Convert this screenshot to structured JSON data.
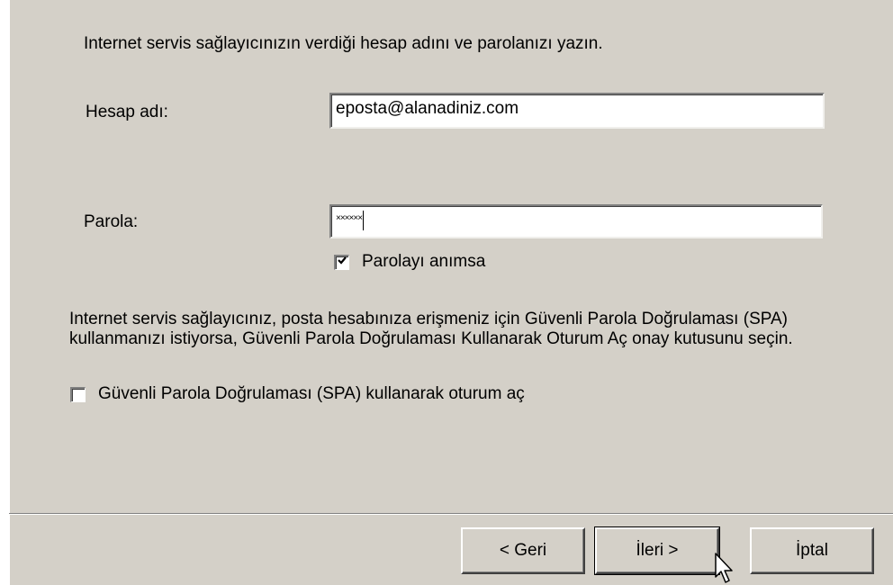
{
  "instruction": "Internet servis sağlayıcınızın verdiği hesap adını ve parolanızı yazın.",
  "account": {
    "label": "Hesap adı:",
    "value": "eposta@alanadiniz.com"
  },
  "password": {
    "label": "Parola:",
    "masked_value": "××××××"
  },
  "remember_password": {
    "label": "Parolayı anımsa",
    "checked": true
  },
  "spa_info": "Internet servis sağlayıcınız, posta hesabınıza erişmeniz için Güvenli Parola Doğrulaması (SPA) kullanmanızı istiyorsa, Güvenli Parola Doğrulaması Kullanarak Oturum Aç onay kutusunu seçin.",
  "spa": {
    "label": "Güvenli Parola Doğrulaması (SPA) kullanarak oturum aç",
    "checked": false
  },
  "buttons": {
    "back": "< Geri",
    "next": "İleri >",
    "cancel": "İptal"
  },
  "colors": {
    "dialog_face": "#d4d0c8",
    "input_bg": "#ffffff"
  }
}
